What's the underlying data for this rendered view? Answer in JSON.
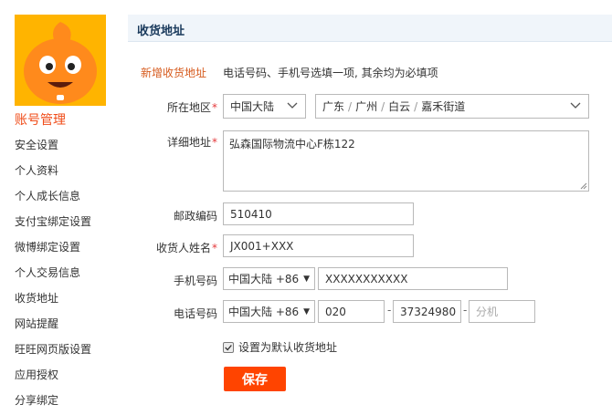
{
  "sidebar": {
    "title": "账号管理",
    "items": [
      {
        "label": "安全设置"
      },
      {
        "label": "个人资料"
      },
      {
        "label": "个人成长信息"
      },
      {
        "label": "支付宝绑定设置"
      },
      {
        "label": "微博绑定设置"
      },
      {
        "label": "个人交易信息"
      },
      {
        "label": "收货地址"
      },
      {
        "label": "网站提醒"
      },
      {
        "label": "旺旺网页版设置"
      },
      {
        "label": "应用授权"
      },
      {
        "label": "分享绑定"
      }
    ]
  },
  "header": {
    "title": "收货地址"
  },
  "form": {
    "section_label": "新增收货地址",
    "hint": "电话号码、手机号选填一项, 其余均为必填项",
    "required_mark": "*",
    "region": {
      "label": "所在地区",
      "country": "中国大陆",
      "province": "广东",
      "city": "广州",
      "district": "白云",
      "street": "嘉禾街道",
      "separator": "/"
    },
    "address": {
      "label": "详细地址",
      "value": "弘森国际物流中心F栋122"
    },
    "postcode": {
      "label": "邮政编码",
      "value": "510410"
    },
    "recipient": {
      "label": "收货人姓名",
      "value": "JX001+XXX"
    },
    "mobile": {
      "label": "手机号码",
      "country_code": "中国大陆 +86",
      "value": "XXXXXXXXXXX"
    },
    "phone": {
      "label": "电话号码",
      "country_code": "中国大陆 +86",
      "area_code": "020",
      "number": "37324980",
      "extension_placeholder": "分机",
      "dash": "-"
    },
    "default_checkbox": {
      "label": "设置为默认收货地址",
      "checked": true
    },
    "save_label": "保存"
  },
  "colors": {
    "accent": "#ff4400",
    "header_bg": "#f0f5fa",
    "section_label": "#d65a1c",
    "required": "#e4393c",
    "avatar_bg": "#ffb400"
  }
}
